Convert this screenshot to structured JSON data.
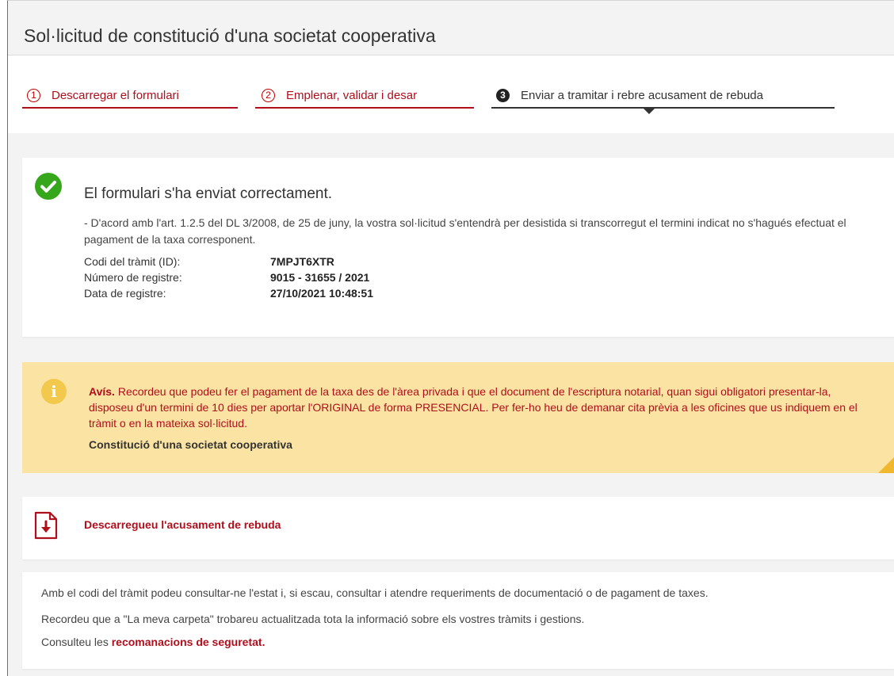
{
  "page": {
    "title": "Sol·licitud de constitució d'una societat cooperativa"
  },
  "steps": [
    {
      "number": "1",
      "label": "Descarregar el formulari",
      "state": "done"
    },
    {
      "number": "2",
      "label": "Emplenar, validar i desar",
      "state": "done"
    },
    {
      "number": "3",
      "label": "Enviar a tramitar i rebre acusament de rebuda",
      "state": "active"
    }
  ],
  "success": {
    "icon": "check-circle-icon",
    "title": "El formulari s'ha enviat correctament.",
    "note": "- D'acord amb l'art. 1.2.5 del DL 3/2008, de 25 de juny, la vostra sol·licitud s'entendrà per desistida si transcorregut el termini indicat no s'hagués efectuat el pagament de la taxa corresponent.",
    "rows": [
      {
        "label": "Codi del tràmit (ID):",
        "value": "7MPJT6XTR"
      },
      {
        "label": "Número de registre:",
        "value": "9015 - 31655 / 2021"
      },
      {
        "label": "Data de registre:",
        "value": "27/10/2021 10:48:51"
      }
    ]
  },
  "warning": {
    "icon": "info-icon",
    "prefix": "Avís.",
    "text": " Recordeu que podeu fer el pagament de la taxa des de l'àrea privada i que el document de l'escriptura notarial, quan sigui obligatori presentar-la, disposeu d'un termini de 10 dies per aportar l'ORIGINAL de forma PRESENCIAL. Per fer-ho heu de demanar cita prèvia a les oficines que us indiquem en el tràmit o en la mateixa sol·licitud.",
    "subtitle": "Constitució d'una societat cooperativa"
  },
  "download": {
    "icon": "pdf-download-icon",
    "label": "Descarregueu l'acusament de rebuda"
  },
  "footer": {
    "line1": "Amb el codi del tràmit podeu consultar-ne l'estat i, si escau, consultar i atendre requeriments de documentació o de pagament de taxes.",
    "line2": "Recordeu que a \"La meva carpeta\" trobareu actualitzada tota la informació sobre els vostres tràmits i gestions.",
    "line3_prefix": "Consulteu les ",
    "line3_link": "recomanacions de seguretat."
  },
  "colors": {
    "accent": "#b10e1c",
    "success": "#36a61a",
    "warning_bg": "#fbe4a3",
    "warning_icon": "#f2c94c"
  }
}
